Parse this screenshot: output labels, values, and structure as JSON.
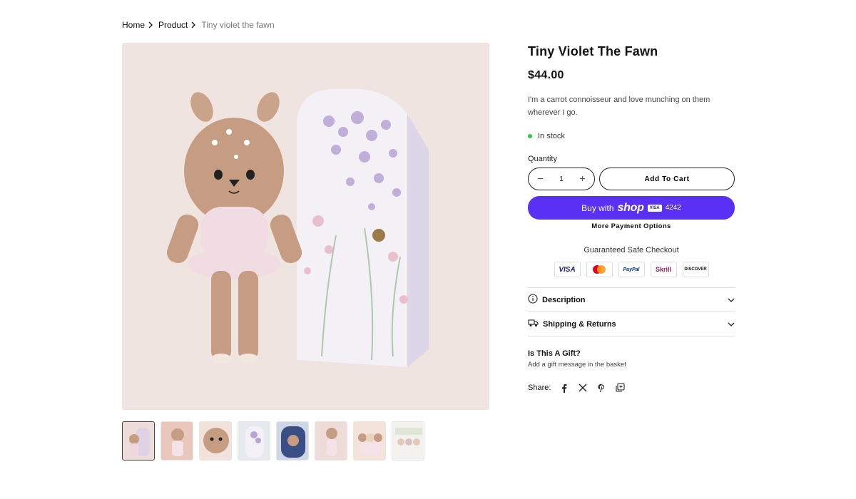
{
  "breadcrumb": {
    "items": [
      {
        "label": "Home"
      },
      {
        "label": "Product"
      },
      {
        "label": "Tiny violet the fawn"
      }
    ]
  },
  "product": {
    "title": "Tiny Violet The Fawn",
    "price": "$44.00",
    "description": "I'm a carrot connoisseur and love munching on them wherever I go.",
    "stock_status": "In stock",
    "stock_color": "#2ecc40",
    "quantity_label": "Quantity",
    "quantity_value": "1",
    "thumbnail_count": 8,
    "active_thumbnail": 1
  },
  "actions": {
    "decrease_icon": "minus-icon",
    "increase_icon": "plus-icon",
    "add_to_cart": "Add To Cart",
    "buy_with": "Buy with",
    "shop_word": "shop",
    "card_brand_mini": "VISA",
    "card_last4": "4242",
    "more_payment_options": "More Payment Options",
    "shop_pay_color": "#5a31f4"
  },
  "checkout": {
    "guaranteed_text": "Guaranteed Safe Checkout",
    "payment_methods": [
      "VISA",
      "Mastercard",
      "PayPal",
      "Skrill",
      "DISCOVER"
    ]
  },
  "accordion": {
    "items": [
      {
        "label": "Description",
        "icon": "info-icon"
      },
      {
        "label": "Shipping & Returns",
        "icon": "truck-icon"
      }
    ]
  },
  "gift": {
    "title": "Is This A Gift?",
    "subtitle": "Add a gift message in the basket"
  },
  "share": {
    "label": "Share:",
    "icons": [
      "facebook-icon",
      "x-icon",
      "pinterest-icon",
      "copy-link-icon"
    ]
  }
}
